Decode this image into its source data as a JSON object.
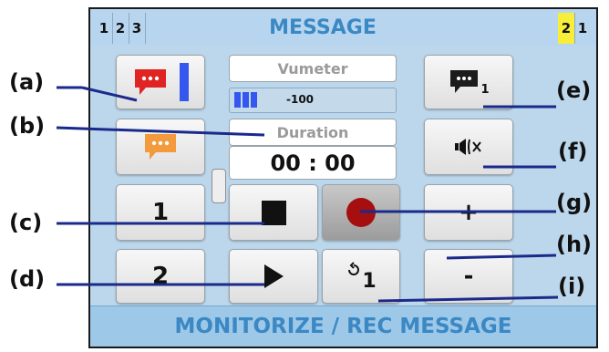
{
  "header": {
    "title": "MESSAGE",
    "left_tabs": [
      "1",
      "2",
      "3"
    ],
    "right_tabs": [
      "2",
      "1"
    ],
    "active_right_tab_index": 0
  },
  "footer": {
    "title": "MONITORIZE / REC MESSAGE"
  },
  "center": {
    "vumeter_label": "Vumeter",
    "vumeter_value": "-100",
    "vumeter_level_bars": 3,
    "duration_label": "Duration",
    "duration_value": "00 : 00"
  },
  "buttons": {
    "message_1": "1",
    "message_2": "2",
    "messages_count_sub": "1",
    "repeat_count": "1",
    "volume_up": "+",
    "volume_down": "-"
  },
  "callouts": {
    "a": "(a)",
    "b": "(b)",
    "c": "(c)",
    "d": "(d)",
    "e": "(e)",
    "f": "(f)",
    "g": "(g)",
    "h": "(h)",
    "i": "(i)"
  },
  "icons": {
    "record_message": "chat-bubble-red-icon",
    "message_orange": "chat-bubble-orange-icon",
    "messages_dark": "chat-bubble-dark-icon",
    "mute": "speaker-mute-icon",
    "stop": "stop-icon",
    "record": "record-icon",
    "play": "play-icon",
    "repeat": "repeat-icon"
  },
  "colors": {
    "panel_bg": "#bcd7ec",
    "title_text": "#3a88c4",
    "active_tab": "#f6ee3a",
    "record_red": "#a50f0f",
    "bubble_red": "#e02424",
    "bubble_orange": "#f39a3d",
    "level_blue": "#3557ee"
  }
}
